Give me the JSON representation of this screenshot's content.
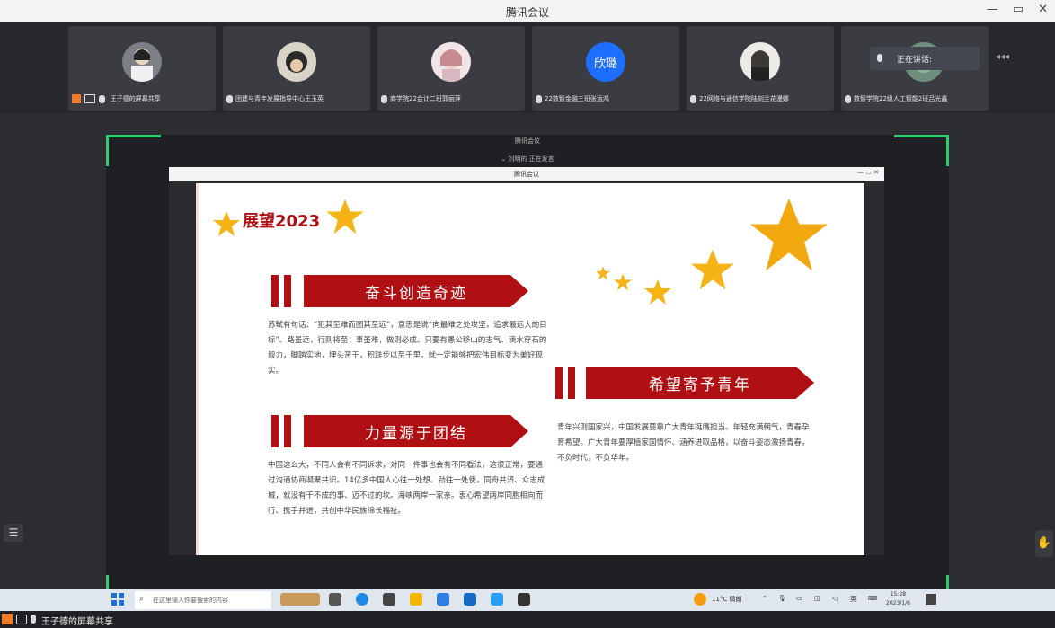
{
  "window": {
    "title": "腾讯会议",
    "minimize": "—",
    "restore": "▭",
    "close": "✕"
  },
  "participants": [
    {
      "name": "王子德的屏幕共享",
      "avatar": "photo"
    },
    {
      "name": "团建与青年发展指导中心王玉英",
      "avatar": "photo"
    },
    {
      "name": "商学院22会计二班郭丽萍",
      "avatar": "photo"
    },
    {
      "name": "22数智金融三班张运鸿",
      "avatar": "欣璐"
    },
    {
      "name": "22网络与通信学院陆刻兰花漫娜",
      "avatar": "photo"
    },
    {
      "name": "数智学院22级人工智能2班吕光鑫",
      "avatar": "photo"
    }
  ],
  "speaking": {
    "label": "正在讲话:"
  },
  "share_header": {
    "app": "腾讯会议",
    "status": "刘明的 正在发言"
  },
  "inner_window": {
    "title": "腾讯会议"
  },
  "slide": {
    "title": "展望2023",
    "section1": {
      "heading": "奋斗创造奇迹",
      "text": "苏轼有句话：“犯其至难而图其至远”，意思是说“向最难之处攻坚，追求最远大的目标”。路虽远，行则将至；事虽难，做则必成。只要有愚公移山的志气、滴水穿石的毅力，脚踏实地，埋头苦干，积跬步以至千里，就一定能够把宏伟目标变为美好现实。"
    },
    "section2": {
      "heading": "力量源于团结",
      "text": "中国这么大，不同人会有不同诉求，对同一件事也会有不同看法，这很正常，要通过沟通协商凝聚共识。14亿多中国人心往一处想、劲往一处使，同舟共济、众志成城，就没有干不成的事、迈不过的坎。海峡两岸一家亲。衷心希望两岸同胞相向而行、携手并进，共创中华民族绵长福祉。"
    },
    "section3": {
      "heading": "希望寄予青年",
      "text": "青年兴则国家兴，中国发展要靠广大青年挺膺担当。年轻充满朝气，青春孕育希望。广大青年要厚植家国情怀、涵养进取品格，以奋斗姿态激扬青春，不负时代，不负华年。"
    }
  },
  "taskbar": {
    "search_placeholder": "在这里输入你要搜索的内容",
    "weather": "11°C 晴朗",
    "ime": "英",
    "time": "15:28",
    "date": "2023/1/6"
  },
  "bottom": {
    "share_label": "王子德的屏幕共享"
  },
  "colors": {
    "accent_green": "#2ecc71",
    "slide_red": "#b00f13",
    "star": "#f5b316"
  }
}
